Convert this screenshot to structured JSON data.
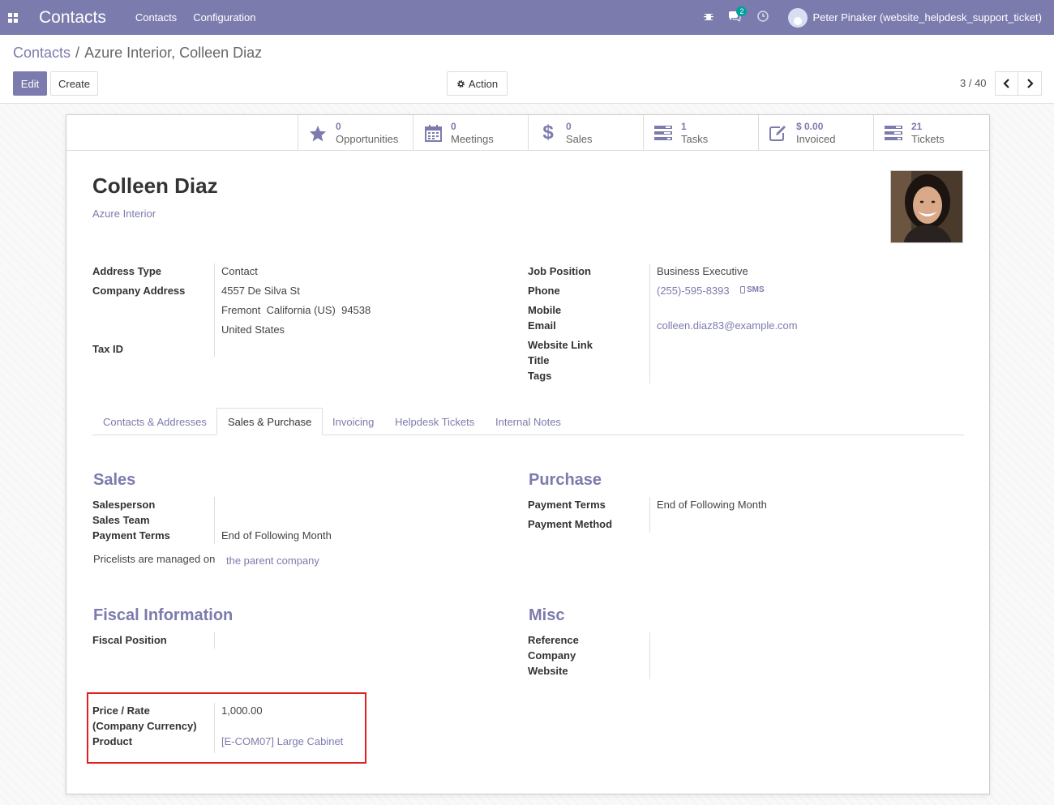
{
  "topbar": {
    "app_name": "Contacts",
    "menu": [
      "Contacts",
      "Configuration"
    ],
    "messages_count": "2",
    "user_name": "Peter Pinaker (website_helpdesk_support_ticket)"
  },
  "breadcrumb": {
    "parent": "Contacts",
    "current": "Azure Interior, Colleen Diaz"
  },
  "toolbar": {
    "edit_label": "Edit",
    "create_label": "Create",
    "action_label": "Action",
    "pager": "3 / 40"
  },
  "smart_buttons": [
    {
      "icon": "star-icon",
      "value": "0",
      "label": "Opportunities"
    },
    {
      "icon": "calendar-icon",
      "value": "0",
      "label": "Meetings"
    },
    {
      "icon": "dollar-icon",
      "value": "0",
      "label": "Sales"
    },
    {
      "icon": "tasks-icon",
      "value": "1",
      "label": "Tasks"
    },
    {
      "icon": "edit-square-icon",
      "value": "$ 0.00",
      "label": "Invoiced"
    },
    {
      "icon": "tickets-icon",
      "value": "21",
      "label": "Tickets"
    }
  ],
  "contact": {
    "name": "Colleen Diaz",
    "company": "Azure Interior"
  },
  "left_fields": {
    "address_type_label": "Address Type",
    "address_type": "Contact",
    "company_address_label": "Company Address",
    "street": "4557 De Silva St",
    "city_line": "Fremont  California (US)  94538",
    "country": "United States",
    "tax_id_label": "Tax ID"
  },
  "right_fields": {
    "job_position_label": "Job Position",
    "job_position": "Business Executive",
    "phone_label": "Phone",
    "phone": "(255)-595-8393",
    "sms_label": "SMS",
    "mobile_label": "Mobile",
    "email_label": "Email",
    "email": "colleen.diaz83@example.com",
    "website_label": "Website Link",
    "title_label": "Title",
    "tags_label": "Tags"
  },
  "tabs": [
    "Contacts & Addresses",
    "Sales & Purchase",
    "Invoicing",
    "Helpdesk Tickets",
    "Internal Notes"
  ],
  "sales": {
    "title": "Sales",
    "salesperson_label": "Salesperson",
    "sales_team_label": "Sales Team",
    "payment_terms_label": "Payment Terms",
    "payment_terms": "End of Following Month",
    "pricelist_text": "Pricelists are managed on",
    "pricelist_link": "the parent company"
  },
  "purchase": {
    "title": "Purchase",
    "payment_terms_label": "Payment Terms",
    "payment_terms": "End of Following Month",
    "payment_method_label": "Payment Method"
  },
  "fiscal": {
    "title": "Fiscal Information",
    "fiscal_position_label": "Fiscal Position"
  },
  "misc": {
    "title": "Misc",
    "reference_label": "Reference",
    "company_label": "Company",
    "website_label": "Website"
  },
  "price": {
    "price_label_1": "Price / Rate",
    "price_label_2": "(Company Currency)",
    "price_value": "1,000.00",
    "product_label": "Product",
    "product_value": "[E-COM07] Large Cabinet"
  },
  "colors": {
    "brand": "#7c7bad",
    "highlight": "#e02020"
  }
}
